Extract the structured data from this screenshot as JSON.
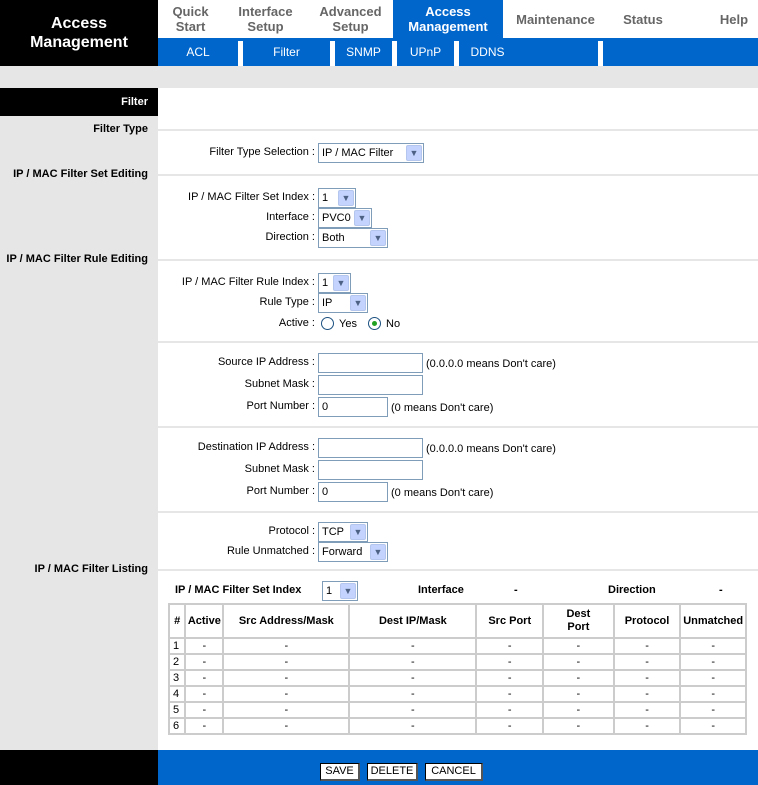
{
  "brand": {
    "title_line1": "Access",
    "title_line2": "Management"
  },
  "nav": {
    "tabs": [
      {
        "l1": "Quick",
        "l2": "Start"
      },
      {
        "l1": "Interface",
        "l2": "Setup"
      },
      {
        "l1": "Advanced",
        "l2": "Setup"
      },
      {
        "l1": "Access",
        "l2": "Management"
      },
      {
        "l1": "Maintenance"
      },
      {
        "l1": "Status"
      },
      {
        "l1": "Help"
      }
    ],
    "active": "Access Management",
    "subtabs": [
      "ACL",
      "Filter",
      "SNMP",
      "UPnP",
      "DDNS"
    ]
  },
  "colors": {
    "accent": "#0066cc",
    "sidebar": "#e6e6e6",
    "header": "#000000"
  },
  "page": {
    "filter_bar": "Filter",
    "sections": {
      "filter_type": "Filter Type",
      "set_editing": "IP / MAC Filter Set Editing",
      "rule_editing": "IP / MAC Filter Rule Editing",
      "listing": "IP / MAC Filter Listing"
    },
    "filter_type_selection": {
      "label": "Filter Type Selection :",
      "value": "IP / MAC Filter"
    },
    "set_index": {
      "label": "IP / MAC Filter Set Index :",
      "value": "1"
    },
    "interface": {
      "label": "Interface :",
      "value": "PVC0"
    },
    "direction": {
      "label": "Direction :",
      "value": "Both"
    },
    "rule_index": {
      "label": "IP / MAC Filter Rule Index :",
      "value": "1"
    },
    "rule_type": {
      "label": "Rule Type :",
      "value": "IP"
    },
    "active": {
      "label": "Active :",
      "yes": "Yes",
      "no": "No",
      "selected": "No"
    },
    "src_ip": {
      "label": "Source IP Address :",
      "value": "",
      "note": "(0.0.0.0 means Don't care)"
    },
    "src_mask": {
      "label": "Subnet Mask :",
      "value": ""
    },
    "src_port": {
      "label": "Port Number :",
      "value": "0",
      "note": "(0 means Don't care)"
    },
    "dst_ip": {
      "label": "Destination IP Address :",
      "value": "",
      "note": "(0.0.0.0 means Don't care)"
    },
    "dst_mask": {
      "label": "Subnet Mask :",
      "value": ""
    },
    "dst_port": {
      "label": "Port Number :",
      "value": "0",
      "note": "(0 means Don't care)"
    },
    "protocol": {
      "label": "Protocol :",
      "value": "TCP"
    },
    "rule_unmatched": {
      "label": "Rule Unmatched :",
      "value": "Forward"
    },
    "listing": {
      "set_index_label": "IP / MAC Filter Set Index",
      "set_index_value": "1",
      "interface_label": "Interface",
      "interface_value": "-",
      "direction_label": "Direction",
      "direction_value": "-",
      "columns": [
        "#",
        "Active",
        "Src Address/Mask",
        "Dest IP/Mask",
        "Src Port",
        "Dest Port",
        "Protocol",
        "Unmatched"
      ],
      "rows": [
        [
          "1",
          "-",
          "-",
          "-",
          "-",
          "-",
          "-",
          "-"
        ],
        [
          "2",
          "-",
          "-",
          "-",
          "-",
          "-",
          "-",
          "-"
        ],
        [
          "3",
          "-",
          "-",
          "-",
          "-",
          "-",
          "-",
          "-"
        ],
        [
          "4",
          "-",
          "-",
          "-",
          "-",
          "-",
          "-",
          "-"
        ],
        [
          "5",
          "-",
          "-",
          "-",
          "-",
          "-",
          "-",
          "-"
        ],
        [
          "6",
          "-",
          "-",
          "-",
          "-",
          "-",
          "-",
          "-"
        ]
      ]
    }
  },
  "footer": {
    "save": "SAVE",
    "delete": "DELETE",
    "cancel": "CANCEL"
  }
}
